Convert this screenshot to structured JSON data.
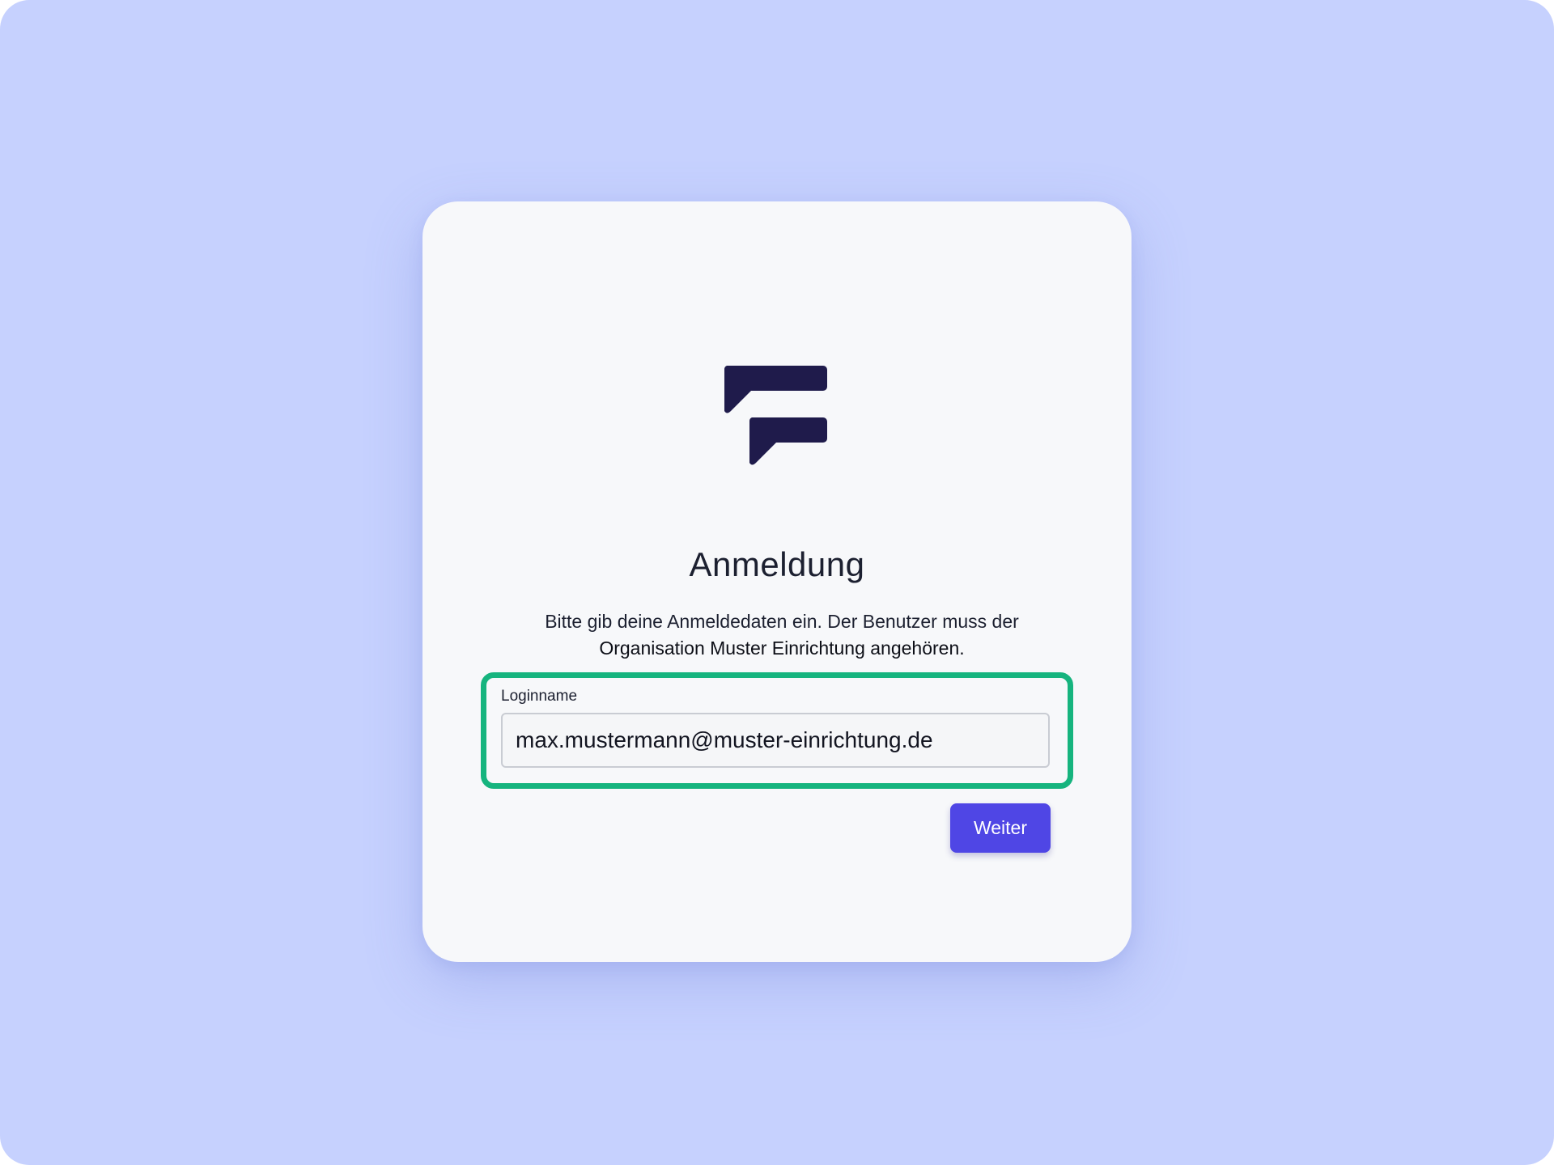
{
  "colors": {
    "background": "#c6d1fe",
    "card": "#f7f8fa",
    "logo": "#1f1b4b",
    "highlight": "#16b47e",
    "primary_button": "#4f46e5"
  },
  "logo": {
    "icon": "chat-bubbles-logo-icon"
  },
  "login": {
    "title": "Anmeldung",
    "description_line1": "Bitte gib deine Anmeldedaten ein. Der Benutzer muss der",
    "description_line2": "Organisation Muster Einrichtung angehören.",
    "field_label": "Loginname",
    "field_value": "max.mustermann@muster-einrichtung.de",
    "submit_label": "Weiter"
  }
}
